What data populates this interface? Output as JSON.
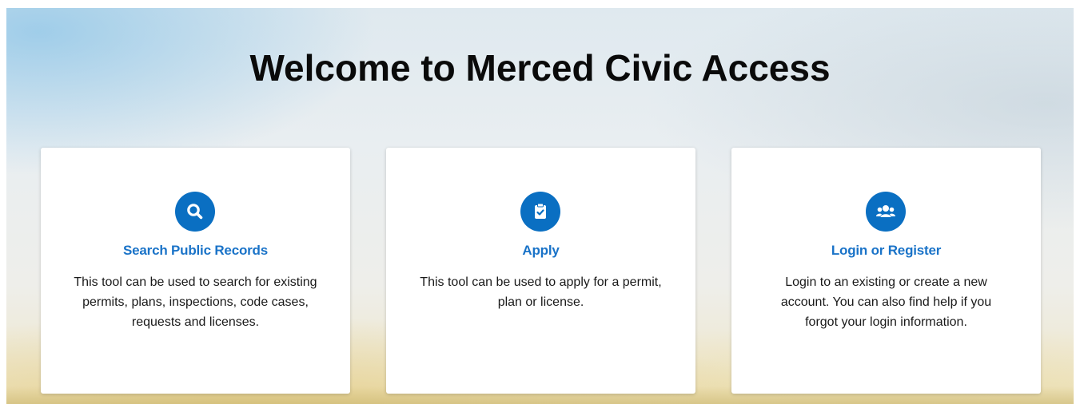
{
  "page": {
    "title": "Welcome to Merced Civic Access"
  },
  "cards": [
    {
      "icon": "search-icon",
      "title": "Search Public Records",
      "description": "This tool can be used to search for existing permits, plans, inspections, code cases, requests and licenses."
    },
    {
      "icon": "clipboard-check-icon",
      "title": "Apply",
      "description": "This tool can be used to apply for a permit, plan or license."
    },
    {
      "icon": "users-icon",
      "title": "Login or Register",
      "description": "Login to an existing or create a new account. You can also find help if you forgot your login information."
    }
  ],
  "colors": {
    "accent": "#0a6fc2",
    "link": "#1a73c8",
    "card_background": "#ffffff",
    "title_text": "#0a0a0a"
  }
}
